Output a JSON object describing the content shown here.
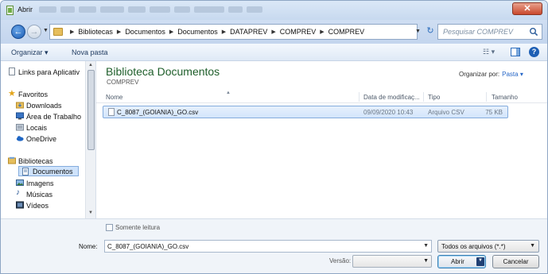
{
  "window": {
    "title": "Abrir"
  },
  "nav": {
    "breadcrumbs": [
      "Bibliotecas",
      "Documentos",
      "Documentos",
      "DATAPREV",
      "COMPREV",
      "COMPREV"
    ],
    "search_placeholder": "Pesquisar COMPREV"
  },
  "toolbar": {
    "organize_label": "Organizar ▾",
    "new_folder_label": "Nova pasta"
  },
  "sidebar": {
    "items": [
      {
        "label": "Links para Aplicativ",
        "icon": "link-page-icon",
        "group": false
      },
      {
        "label": "Favoritos",
        "icon": "star-icon",
        "group": true
      },
      {
        "label": "Downloads",
        "icon": "downloads-folder-icon",
        "group": false
      },
      {
        "label": "Área de Trabalho",
        "icon": "desktop-icon",
        "group": false
      },
      {
        "label": "Locais",
        "icon": "recent-places-icon",
        "group": false
      },
      {
        "label": "OneDrive",
        "icon": "cloud-icon",
        "group": false
      },
      {
        "label": "Bibliotecas",
        "icon": "libraries-icon",
        "group": true
      },
      {
        "label": "Documentos",
        "icon": "documents-icon",
        "group": false,
        "selected": true
      },
      {
        "label": "Imagens",
        "icon": "pictures-icon",
        "group": false
      },
      {
        "label": "Músicas",
        "icon": "music-icon",
        "group": false
      },
      {
        "label": "Vídeos",
        "icon": "videos-icon",
        "group": false
      }
    ]
  },
  "library": {
    "title": "Biblioteca Documentos",
    "subtitle": "COMPREV",
    "arrange_label": "Organizar por:",
    "arrange_value": "Pasta ▾"
  },
  "columns": [
    "Nome",
    "Data de modificaç...",
    "Tipo",
    "Tamanho"
  ],
  "files": [
    {
      "name": "C_8087_(GOIANIA)_GO.csv",
      "modified": "09/09/2020 10:43",
      "type": "Arquivo CSV",
      "size": "75 KB"
    }
  ],
  "bottom": {
    "readonly_label": "Somente leitura",
    "name_label": "Nome:",
    "name_value": "C_8087_(GOIANIA)_GO.csv",
    "filter_value": "Todos os arquivos (*.*)",
    "version_label": "Versão:",
    "open_label": "Abrir",
    "cancel_label": "Cancelar"
  },
  "colors": {
    "accent": "#1e5e2a",
    "selection": "#cfe3fb",
    "titlebar": "#c7d9ef",
    "close": "#c9482c"
  }
}
